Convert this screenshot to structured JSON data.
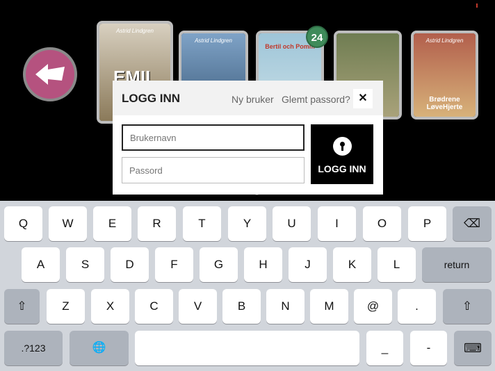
{
  "books": [
    {
      "author": "Astrid Lindgren",
      "title": "EMIL",
      "color": "#c8b89a"
    },
    {
      "author": "Astrid Lindgren",
      "title": "",
      "color": "#7fa3c7"
    },
    {
      "author": "",
      "title": "Bertil och Pomm",
      "color": "#9ec5d8"
    },
    {
      "author": "",
      "title": "",
      "color": "#6f7d52"
    },
    {
      "author": "Astrid Lindgren",
      "title": "Brødrene LøveHjerte",
      "color": "#b25f4c"
    }
  ],
  "badge": "24",
  "dialog": {
    "title": "LOGG INN",
    "new_user": "Ny bruker",
    "forgot": "Glemt passord?",
    "close": "✕",
    "username_placeholder": "Brukernavn",
    "password_placeholder": "Passord",
    "login_label": "LOGG INN"
  },
  "keyboard": {
    "row1": [
      "Q",
      "W",
      "E",
      "R",
      "T",
      "Y",
      "U",
      "I",
      "O",
      "P"
    ],
    "row2": [
      "A",
      "S",
      "D",
      "F",
      "G",
      "H",
      "J",
      "K",
      "L"
    ],
    "row3": [
      "Z",
      "X",
      "C",
      "V",
      "B",
      "N",
      "M",
      "@",
      "."
    ],
    "backspace": "⌫",
    "return": "return",
    "shift": "⇧",
    "numbers": ".?123",
    "globe": "🌐",
    "space": "",
    "underscore": "_",
    "dash": "-",
    "hide": "⌨"
  }
}
